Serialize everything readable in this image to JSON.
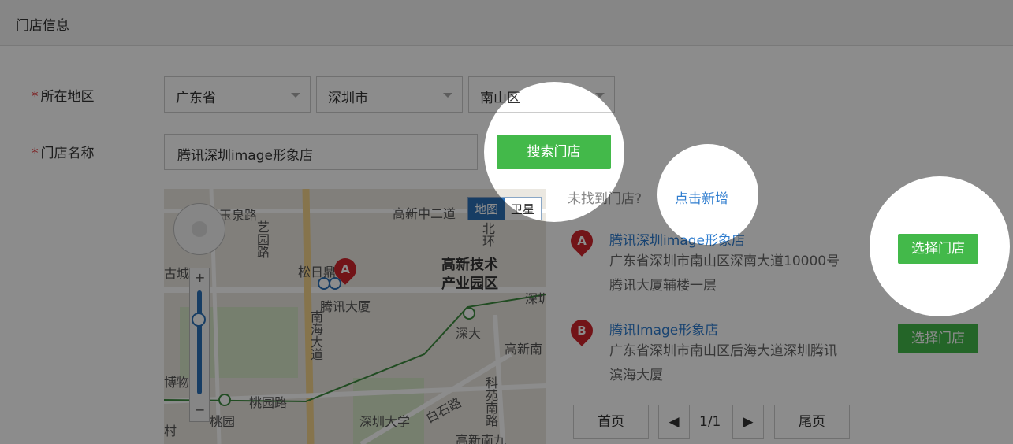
{
  "section_title": "门店信息",
  "form": {
    "region_label": "所在地区",
    "required_mark": "*",
    "province": "广东省",
    "city": "深圳市",
    "district": "南山区",
    "store_name_label": "门店名称",
    "store_name_value": "腾讯深圳image形象店",
    "search_button": "搜索门店"
  },
  "not_found": {
    "text": "未找到门店?",
    "add_link": "点击新增"
  },
  "map": {
    "toggle_map": "地图",
    "toggle_satellite": "卫星",
    "zoom_plus": "+",
    "zoom_minus": "−",
    "labels": {
      "yuquan": "玉泉路",
      "yiyuan": "艺园路",
      "gaoxinzhong": "高新中二道",
      "beihuan": "北环",
      "hightech": "高新技术",
      "industrial_park": "产业园区",
      "songri": "松日鼎",
      "tencent_building": "腾讯大厦",
      "nanhai": "南海大道",
      "shenda": "深大",
      "shenda_univ": "深圳大学",
      "gaoxinnan": "高新南",
      "taoyuan_road": "桃园路",
      "taoyuan": "桃园",
      "baishi": "白石路",
      "keyuan": "科苑南路",
      "gucheng": "古城",
      "museum": "博物中",
      "cun": "村",
      "shenzhen": "深圳",
      "gaoxinnan9": "高新南九"
    },
    "pin_letter": "A"
  },
  "results": [
    {
      "marker": "A",
      "name": "腾讯深圳image形象店",
      "address_line1": "广东省深圳市南山区深南大道10000号",
      "address_line2": "腾讯大厦辅楼一层",
      "action": "选择门店"
    },
    {
      "marker": "B",
      "name": "腾讯Image形象店",
      "address_line1": "广东省深圳市南山区后海大道深圳腾讯",
      "address_line2": "滨海大厦",
      "action": "选择门店"
    }
  ],
  "pagination": {
    "first": "首页",
    "current": "1/1",
    "last": "尾页"
  },
  "colors": {
    "primary_green": "#43b94a",
    "link_blue": "#2f7dcf",
    "required_red": "#e4393c",
    "overlay": "rgba(0,0,0,0.45)"
  }
}
